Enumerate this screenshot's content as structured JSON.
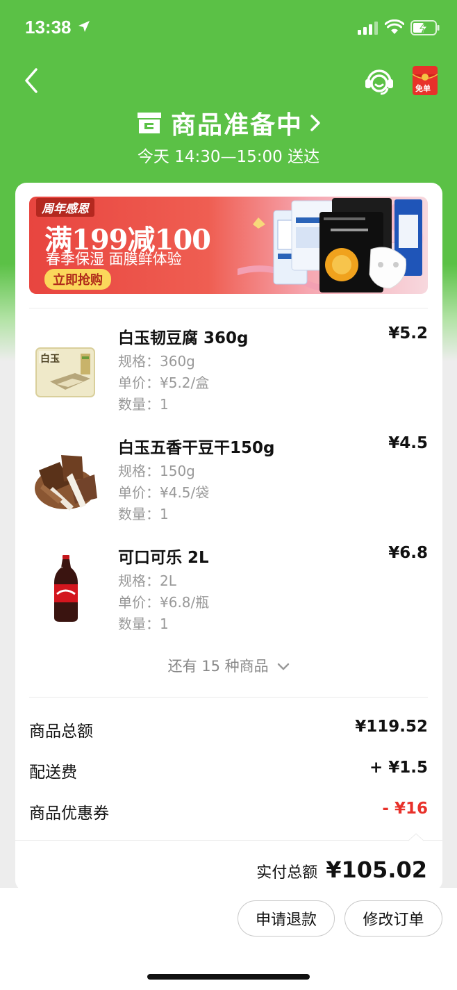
{
  "status_bar": {
    "time": "13:38"
  },
  "header": {
    "order_status": "商品准备中",
    "delivery_time": "今天 14:30—15:00 送达",
    "redpacket_label": "免单"
  },
  "banner": {
    "tag": "周年感恩",
    "headline": "满199减100",
    "subline": "春季保湿 面膜鲜体验",
    "cta": "立即抢购"
  },
  "items": [
    {
      "name": "白玉韧豆腐 360g",
      "price": "¥5.2",
      "spec": "规格：360g",
      "unit_price": "单价：¥5.2/盒",
      "qty": "数量：1",
      "thumb_label": "白玉"
    },
    {
      "name": "白玉五香干豆干150g",
      "price": "¥4.5",
      "spec": "规格：150g",
      "unit_price": "单价：¥4.5/袋",
      "qty": "数量：1"
    },
    {
      "name": "可口可乐 2L",
      "price": "¥6.8",
      "spec": "规格：2L",
      "unit_price": "单价：¥6.8/瓶",
      "qty": "数量：1"
    }
  ],
  "more_items": "还有 15 种商品",
  "summary": {
    "goods_total_label": "商品总额",
    "goods_total": "¥119.52",
    "delivery_fee_label": "配送费",
    "delivery_fee": "+ ¥1.5",
    "coupon_label": "商品优惠券",
    "coupon": "- ¥16",
    "paid_label": "实付总额",
    "paid": "¥105.02"
  },
  "actions": {
    "refund": "申请退款",
    "modify": "修改订单"
  },
  "colors": {
    "brand_green": "#5bc146",
    "discount_red": "#e8312a"
  }
}
